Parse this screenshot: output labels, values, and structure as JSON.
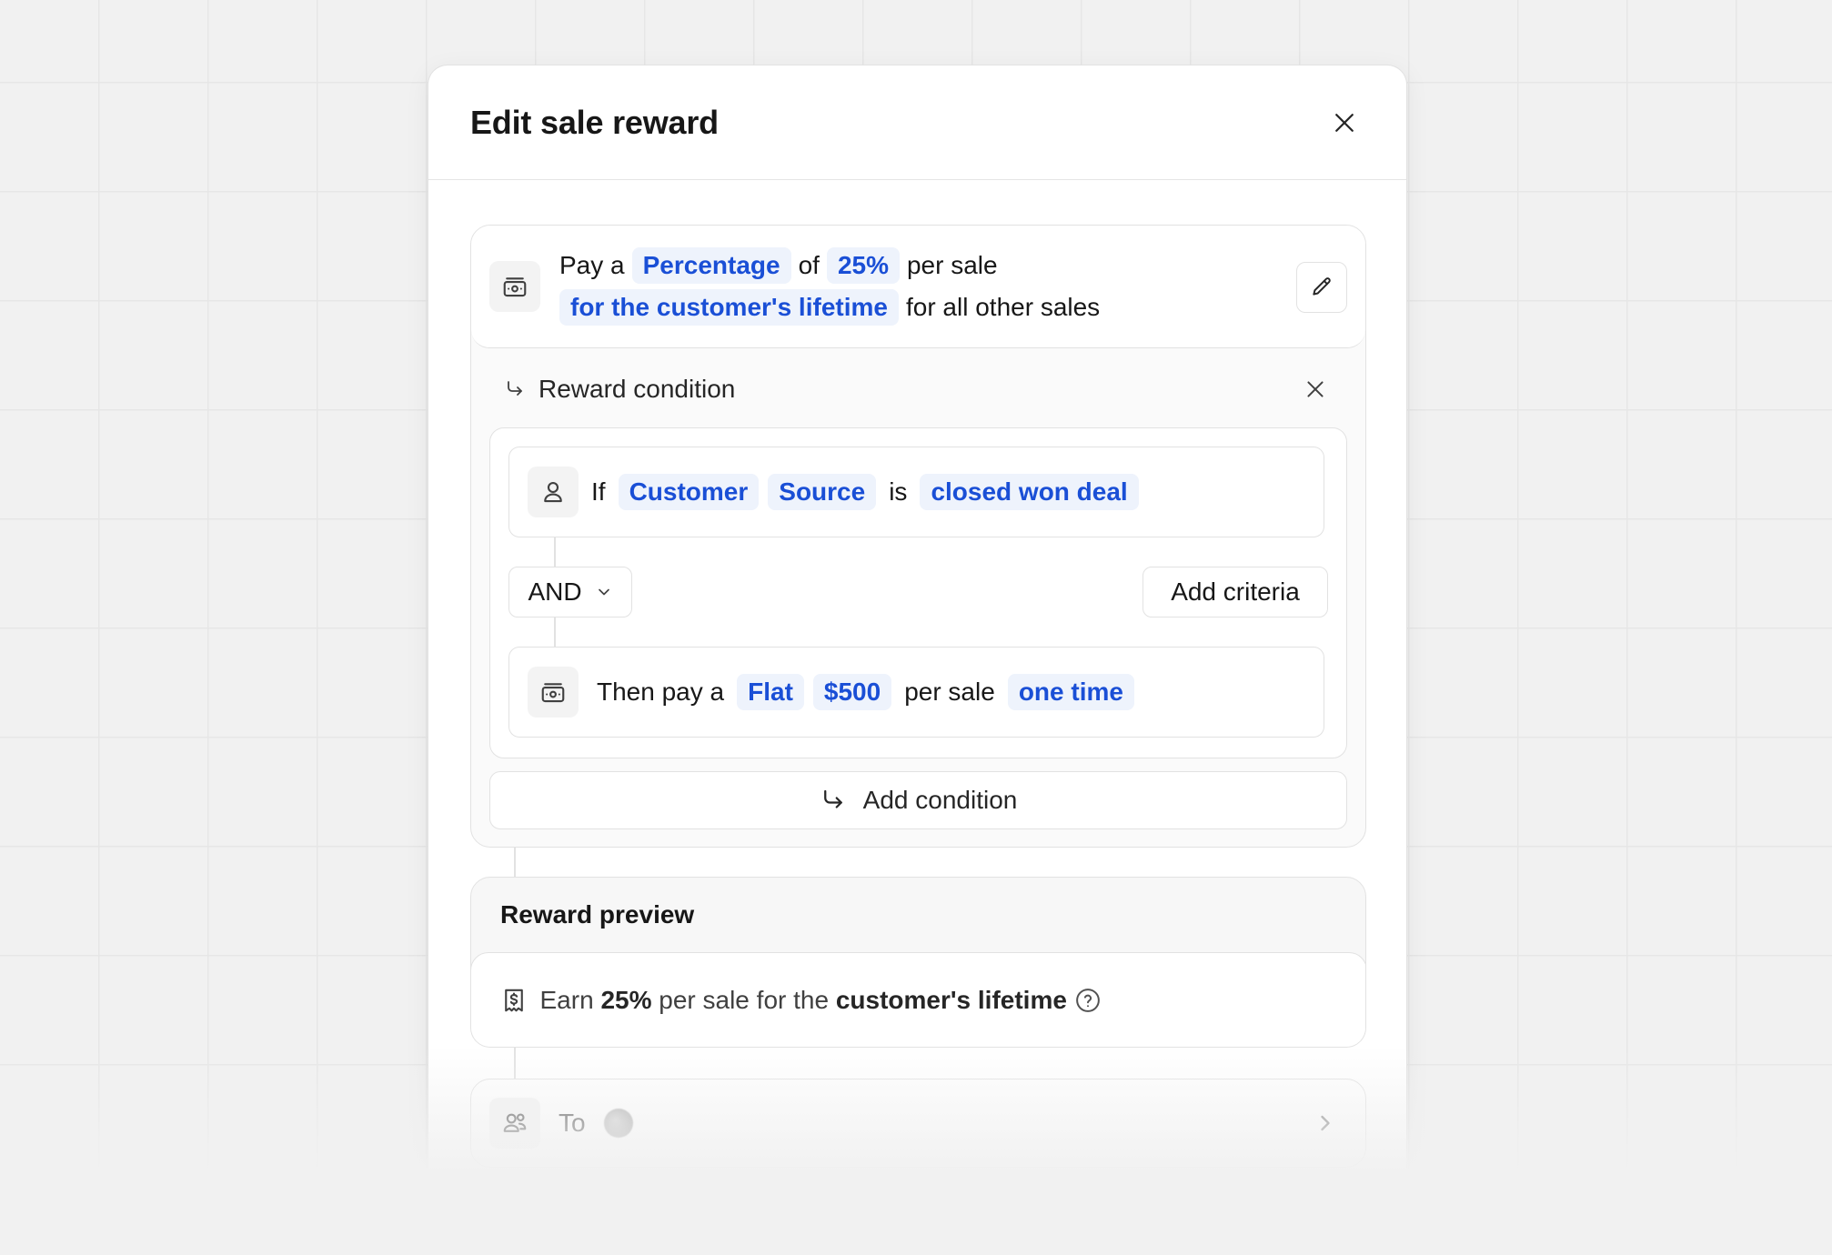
{
  "modal": {
    "title": "Edit sale reward"
  },
  "reward": {
    "line1": {
      "pay": "Pay a",
      "type": "Percentage",
      "of": "of",
      "amount": "25%",
      "per": "per sale"
    },
    "line2": {
      "duration": "for the customer's lifetime",
      "scope": "for all other sales"
    }
  },
  "condition": {
    "title": "Reward condition",
    "if_row": {
      "if": "If",
      "entity": "Customer",
      "attribute": "Source",
      "operator": "is",
      "value": "closed won deal"
    },
    "and_label": "AND",
    "add_criteria": "Add criteria",
    "then_row": {
      "then": "Then pay a",
      "type": "Flat",
      "amount": "$500",
      "per": "per sale",
      "duration": "one time"
    }
  },
  "add_condition": "Add condition",
  "preview": {
    "title": "Reward preview",
    "earn": "Earn",
    "amount": "25%",
    "mid": "per sale for the",
    "duration": "customer's lifetime"
  },
  "to": {
    "label": "To"
  },
  "icons": [
    "close-icon",
    "money-icon",
    "pencil-icon",
    "arrow-turn-icon",
    "user-icon",
    "chevron-down-icon",
    "receipt-dollar-icon",
    "help-circle-icon",
    "users-icon",
    "chevron-right-icon"
  ],
  "colors": {
    "chip_bg": "#eef3fc",
    "chip_text": "#1a4fd6",
    "background": "#f1f1f1",
    "border": "#e2e2e2"
  }
}
